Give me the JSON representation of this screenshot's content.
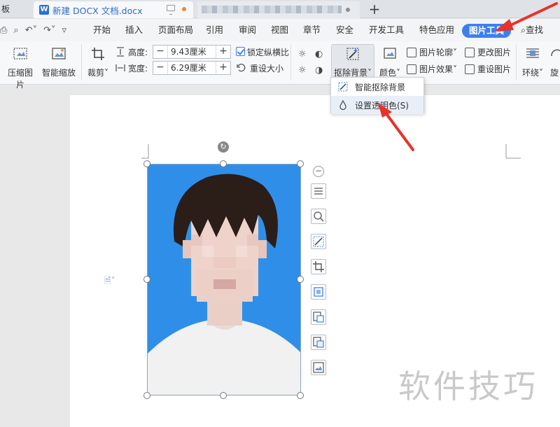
{
  "tabs": {
    "prev_tab_label": "板",
    "active_tab_title": "新建 DOCX 文档.docx",
    "new_tab_symbol": "+"
  },
  "menu": {
    "items": [
      "开始",
      "插入",
      "页面布局",
      "引用",
      "审阅",
      "视图",
      "章节",
      "安全",
      "开发工具",
      "特色应用",
      "图片工具"
    ],
    "active_item": "图片工具",
    "find_label": "查找"
  },
  "ribbon": {
    "compress_label": "压缩图片",
    "smart_zoom_label": "智能缩放",
    "crop_label": "裁剪",
    "height_label": "高度:",
    "height_value": "9.43厘米",
    "width_label": "宽度:",
    "width_value": "6.29厘米",
    "lock_ratio_label": "锁定纵横比",
    "reset_size_label": "重设大小",
    "remove_bg_label": "抠除背景",
    "color_label": "颜色",
    "outline_label": "图片轮廓",
    "effect_label": "图片效果",
    "change_pic_label": "更改图片",
    "reset_pic_label": "重设图片",
    "wrap_label": "环绕",
    "rotate_label": "旋"
  },
  "dropdown": {
    "items": [
      "智能抠除背景",
      "设置透明色(S)"
    ]
  },
  "watermark": "软件技巧",
  "colors": {
    "accent": "#3d7ff0",
    "photo_bg": "#2f8fe8",
    "arrow": "#e8322c"
  }
}
